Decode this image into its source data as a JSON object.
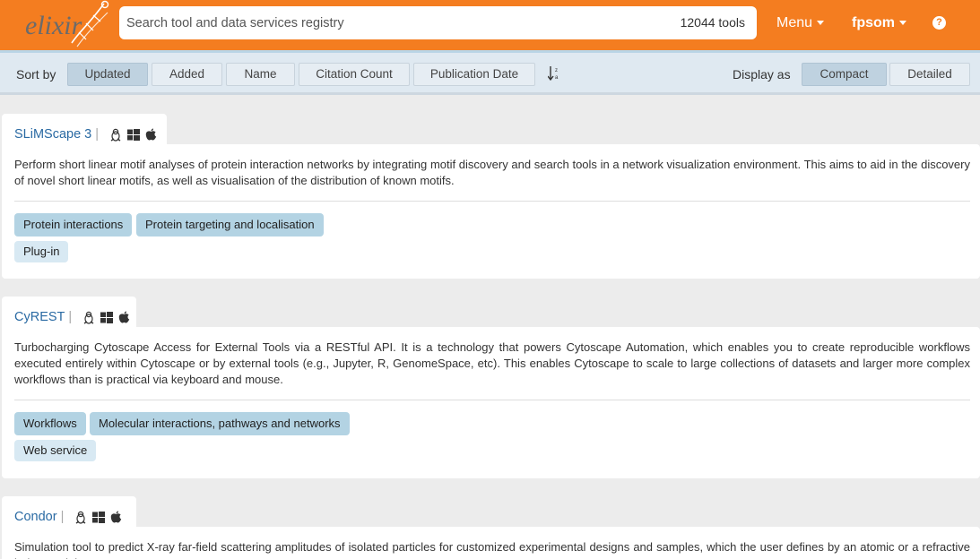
{
  "header": {
    "logo_text": "elixir",
    "search_placeholder": "Search tool and data services registry",
    "tool_count": "12044 tools",
    "menu_label": "Menu",
    "user_label": "fpsom",
    "help_icon": "question-circle-icon"
  },
  "sortbar": {
    "sort_label": "Sort by",
    "sort_options": [
      "Updated",
      "Added",
      "Name",
      "Citation Count",
      "Publication Date"
    ],
    "active_sort": "Updated",
    "display_label": "Display as",
    "display_options": [
      "Compact",
      "Detailed"
    ],
    "active_display": "Compact"
  },
  "tools": [
    {
      "name": "SLiMScape 3",
      "platforms": [
        "linux-icon",
        "windows-icon",
        "apple-icon"
      ],
      "description": "Perform short linear motif analyses of protein interaction networks by integrating motif discovery and search tools in a network visualization environment. This aims to aid in the discovery of novel short linear motifs, as well as visualisation of the distribution of known motifs.",
      "topics": [
        "Protein interactions",
        "Protein targeting and localisation"
      ],
      "types": [
        "Plug-in"
      ]
    },
    {
      "name": "CyREST",
      "platforms": [
        "linux-icon",
        "windows-icon",
        "apple-icon"
      ],
      "description": "Turbocharging Cytoscape Access for External Tools via a RESTful API. It is a technology that powers Cytoscape Automation, which enables you to create reproducible workflows executed entirely within Cytoscape or by external tools (e.g., Jupyter, R, GenomeSpace, etc). This enables Cytoscape to scale to large collections of datasets and larger more complex workflows than is practical via keyboard and mouse.",
      "topics": [
        "Workflows",
        "Molecular interactions, pathways and networks"
      ],
      "types": [
        "Web service"
      ]
    },
    {
      "name": "Condor",
      "platforms": [
        "linux-icon",
        "windows-icon",
        "apple-icon"
      ],
      "description": "Simulation tool to predict X-ray far-field scattering amplitudes of isolated particles for customized experimental designs and samples, which the user defines by an atomic or a refractive index model."
    }
  ]
}
